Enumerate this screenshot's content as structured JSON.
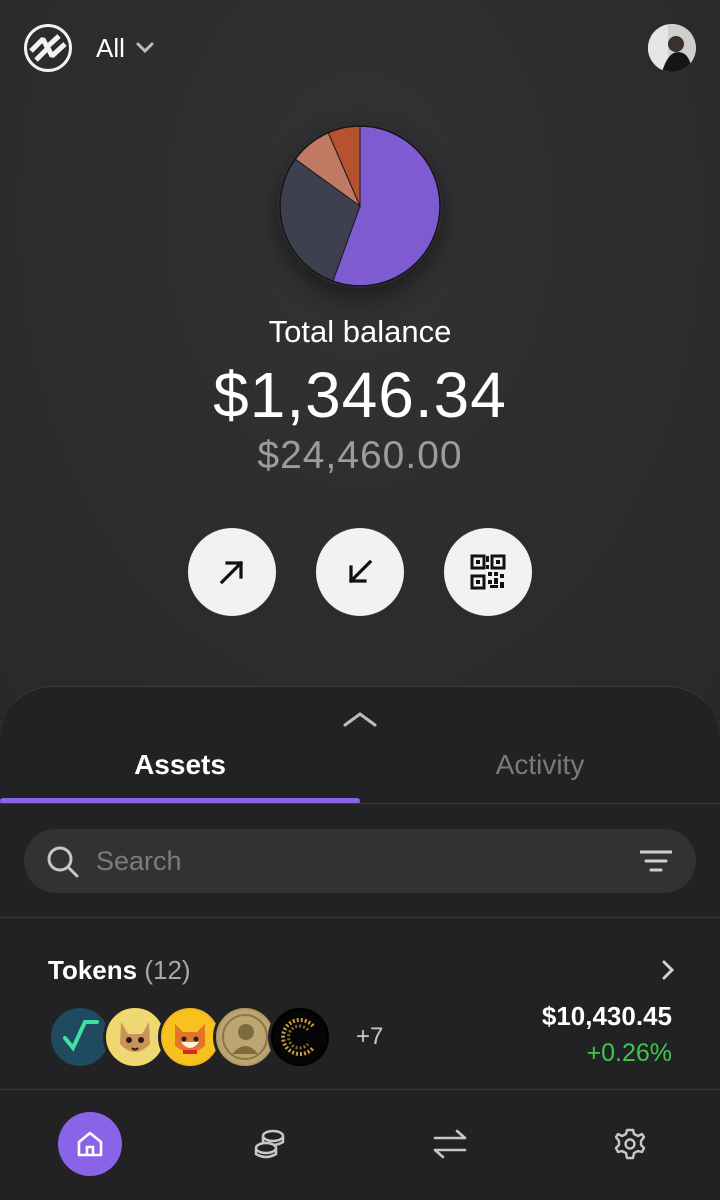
{
  "header": {
    "logo_icon": "wavy-logo-icon",
    "wallet_selector_label": "All",
    "chevron_icon": "chevron-down-icon",
    "avatar_icon": "profile-avatar"
  },
  "portfolio": {
    "chart_slices": [
      {
        "color": "#7f5bd1",
        "fraction": 0.555
      },
      {
        "color": "#3e4050",
        "fraction": 0.295
      },
      {
        "color": "#c07a63",
        "fraction": 0.085
      },
      {
        "color": "#b6532e",
        "fraction": 0.065
      }
    ],
    "total_label": "Total balance",
    "total_value": "$1,346.34",
    "secondary_value": "$24,460.00"
  },
  "actions": [
    {
      "icon": "arrow-up-right-icon",
      "name": "send"
    },
    {
      "icon": "arrow-down-left-icon",
      "name": "receive"
    },
    {
      "icon": "qr-code-icon",
      "name": "qr"
    }
  ],
  "sheet": {
    "handle_icon": "chevron-up-icon",
    "tabs": [
      {
        "label": "Assets",
        "active": true
      },
      {
        "label": "Activity",
        "active": false
      }
    ],
    "search": {
      "placeholder": "Search",
      "search_icon": "search-icon",
      "filter_icon": "filter-icon"
    },
    "tokens": {
      "title": "Tokens",
      "count": "(12)",
      "more_count": "+7",
      "value": "$10,430.45",
      "change": "+0.26%",
      "icons": [
        "sqrt-token-icon",
        "cat-token-icon",
        "shiba-token-icon",
        "portrait-coin-icon",
        "circle-token-icon"
      ]
    }
  },
  "nav": {
    "items": [
      {
        "icon": "home-icon",
        "active": true
      },
      {
        "icon": "coins-icon",
        "active": false
      },
      {
        "icon": "swap-icon",
        "active": false
      },
      {
        "icon": "settings-gear-icon",
        "active": false
      }
    ]
  },
  "colors": {
    "accent": "#8a63e8",
    "positive": "#3cc84a",
    "background": "#2d2d2f",
    "sheet": "#222224"
  }
}
